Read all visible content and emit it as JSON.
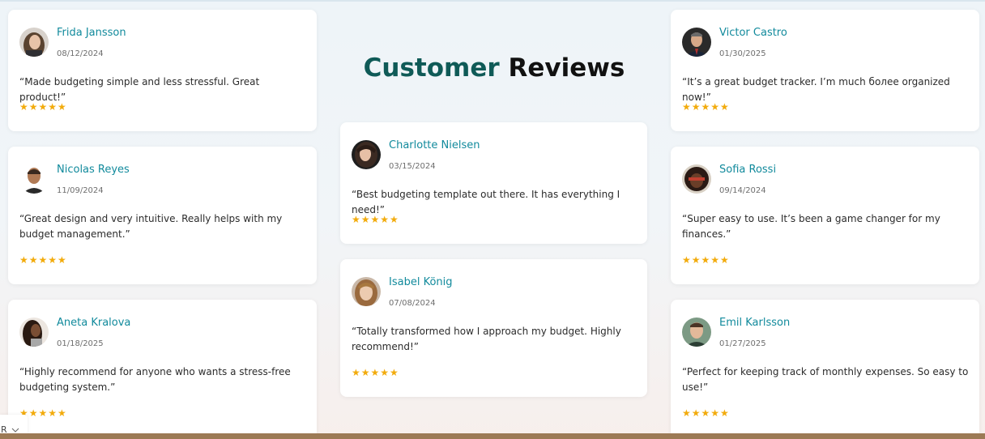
{
  "heading": {
    "part1": "Customer",
    "part2": "Reviews"
  },
  "reviews": [
    {
      "name": "Frida Jansson",
      "date": "08/12/2024",
      "quote": "“Made budgeting simple and less stressful. Great product!”",
      "stars": "★★★★★",
      "rating": 5
    },
    {
      "name": "Nicolas Reyes",
      "date": "11/09/2024",
      "quote": "“Great design and very intuitive. Really helps with my budget management.”",
      "stars": "★★★★★",
      "rating": 5
    },
    {
      "name": "Aneta Kralova",
      "date": "01/18/2025",
      "quote": "“Highly recommend for anyone who wants a stress-free budgeting system.”",
      "stars": "★★★★★",
      "rating": 5
    },
    {
      "name": "Charlotte Nielsen",
      "date": "03/15/2024",
      "quote": "“Best budgeting template out there. It has everything I need!”",
      "stars": "★★★★★",
      "rating": 5
    },
    {
      "name": "Isabel König",
      "date": "07/08/2024",
      "quote": "“Totally transformed how I approach my budget. Highly recommend!”",
      "stars": "★★★★★",
      "rating": 5
    },
    {
      "name": "Victor Castro",
      "date": "01/30/2025",
      "quote": "“It’s a great budget tracker. I’m much более organized now!”",
      "stars": "★★★★★",
      "rating": 5
    },
    {
      "name": "Sofia Rossi",
      "date": "09/14/2024",
      "quote": "“Super easy to use. It’s been a game changer for my finances.”",
      "stars": "★★★★★",
      "rating": 5
    },
    {
      "name": "Emil Karlsson",
      "date": "01/27/2025",
      "quote": "“Perfect for keeping track of monthly expenses. So easy to use!”",
      "stars": "★★★★★",
      "rating": 5
    }
  ],
  "language_selector": {
    "label": "R",
    "icon": "chevron-down-icon"
  },
  "colors": {
    "accent": "#118a9c",
    "heading_brand": "#0f5a57",
    "stars": "#f2ab0c",
    "footer": "#9c7a55"
  }
}
